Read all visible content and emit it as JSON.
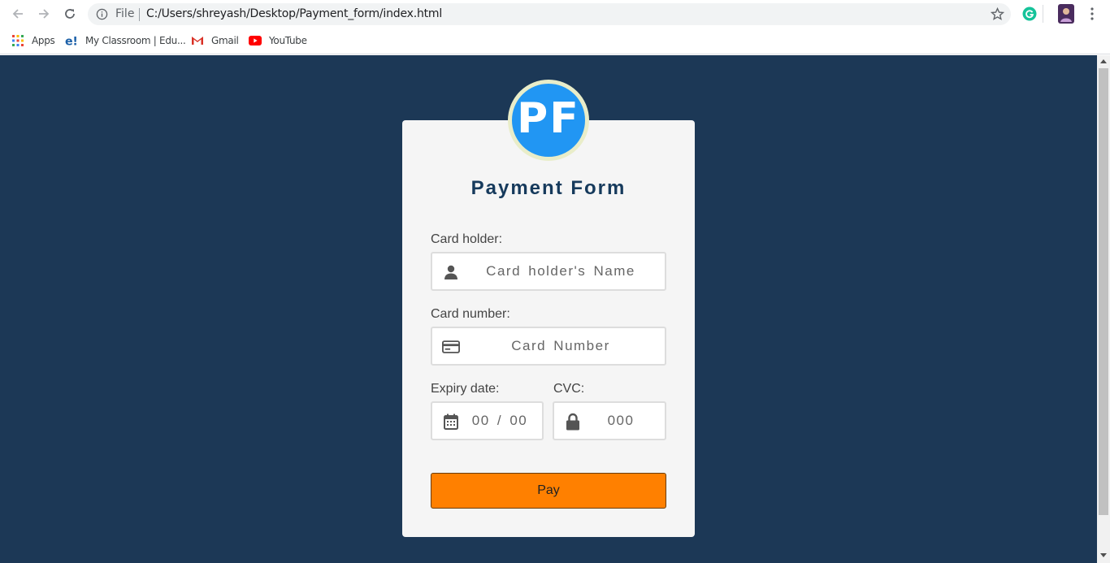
{
  "browser": {
    "omnibox": {
      "scheme_label": "File",
      "url": "C:/Users/shreyash/Desktop/Payment_form/index.html"
    },
    "bookmarks": [
      {
        "label": "Apps",
        "icon": "apps-grid-icon"
      },
      {
        "label": "My Classroom | Edu...",
        "icon": "eduonix-icon"
      },
      {
        "label": "Gmail",
        "icon": "gmail-icon"
      },
      {
        "label": "YouTube",
        "icon": "youtube-icon"
      }
    ]
  },
  "form": {
    "logo_text": "PF",
    "title": "Payment Form",
    "card_holder": {
      "label": "Card holder:",
      "placeholder": "Card holder's Name",
      "icon": "user-icon"
    },
    "card_number": {
      "label": "Card number:",
      "placeholder": "Card Number",
      "icon": "credit-card-icon"
    },
    "expiry": {
      "label": "Expiry date:",
      "placeholder": "00 / 00",
      "icon": "calendar-icon"
    },
    "cvc": {
      "label": "CVC:",
      "placeholder": "000",
      "icon": "lock-icon"
    },
    "pay_label": "Pay"
  },
  "colors": {
    "page_background": "#1c3856",
    "card_background": "#f5f5f5",
    "logo_blue": "#2196f3",
    "title": "#163a5c",
    "pay_button": "#ff8000"
  }
}
